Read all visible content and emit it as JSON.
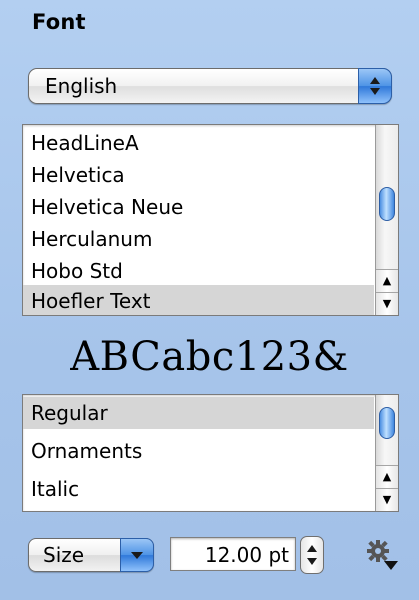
{
  "panel": {
    "title": "Font"
  },
  "collection_popup": {
    "selected": "English"
  },
  "font_list": {
    "items": [
      "HeadLineA",
      "Helvetica",
      "Helvetica Neue",
      "Herculanum",
      "Hobo Std",
      "Hoefler Text"
    ],
    "selected": "Hoefler Text"
  },
  "preview": {
    "text": "ABCabc123&"
  },
  "style_list": {
    "items": [
      "Regular",
      "Ornaments",
      "Italic"
    ],
    "selected": "Regular"
  },
  "size_popup": {
    "label": "Size"
  },
  "size_field": {
    "value": "12.00 pt"
  },
  "icons": {
    "popup_arrows": "up-down-arrows-icon",
    "stepper": "stepper-arrows-icon",
    "action": "gear-icon"
  },
  "colors": {
    "background": "#a9c6ec",
    "selection": "#d6d6d6",
    "aqua_blue": "#4e93e6"
  }
}
